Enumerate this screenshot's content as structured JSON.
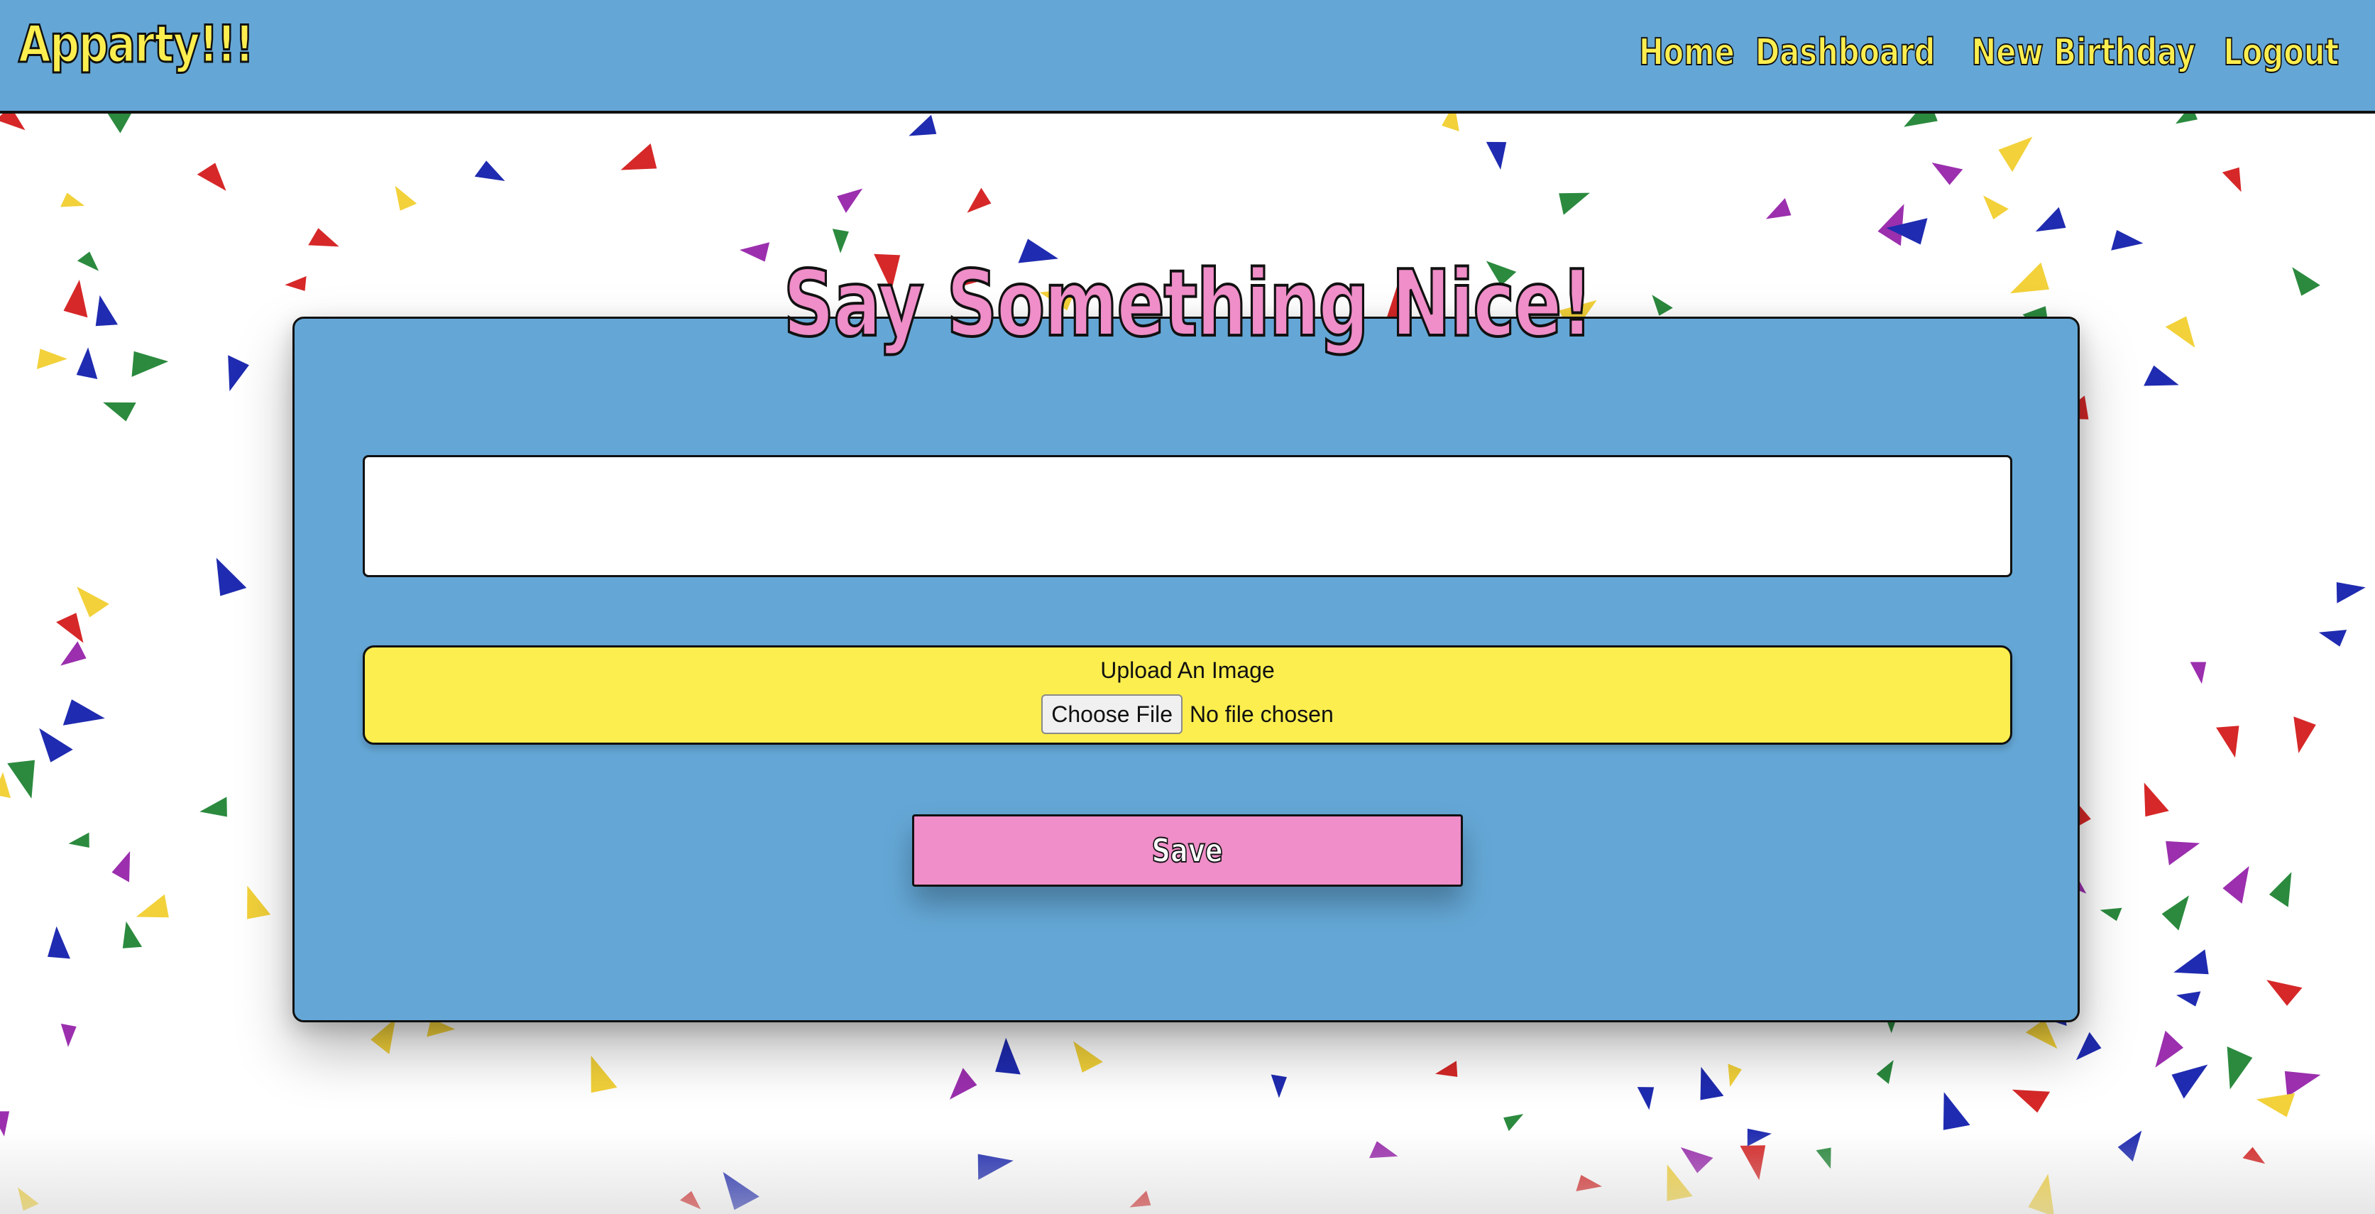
{
  "navbar": {
    "brand": "Apparty!!!",
    "links": [
      {
        "label": "Home"
      },
      {
        "label": "Dashboard"
      },
      {
        "label": "New Birthday"
      },
      {
        "label": "Logout"
      }
    ]
  },
  "main": {
    "heading": "Say Something Nice!",
    "message": {
      "value": "",
      "placeholder": ""
    },
    "upload": {
      "label": "Upload An Image",
      "button_label": "Choose File",
      "status": "No file chosen"
    },
    "save_label": "Save"
  },
  "colors": {
    "navbar_bg": "#64a7d6",
    "brand_yellow": "#fcee4f",
    "accent_pink": "#ef8ec8",
    "card_bg": "#64a7d6",
    "confetti": [
      "#2b8a3e",
      "#d62828",
      "#f2d13a",
      "#9b2fae",
      "#1f2bb0"
    ]
  }
}
